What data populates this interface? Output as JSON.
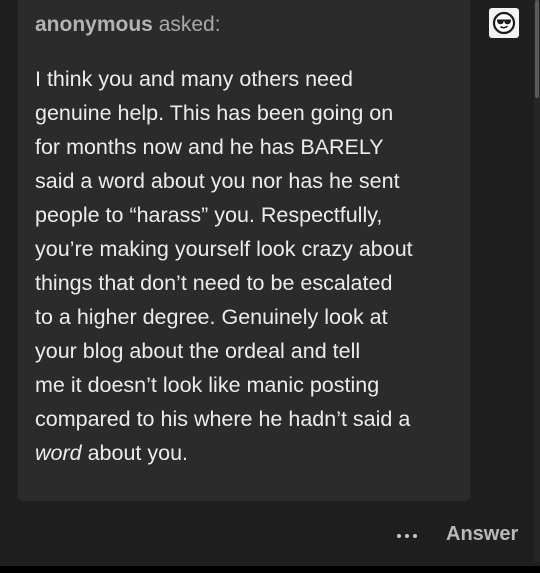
{
  "ask": {
    "asker_name": "anonymous",
    "asked_label": "asked:",
    "question_lines": [
      "I think you and many others need",
      "genuine help. This has been going on",
      "for months now and he has BARELY",
      "said a word about you nor has he sent",
      "people to “harass” you. Respectfully,",
      "you’re making yourself look crazy about",
      "things that don’t need to be escalated",
      "to a higher degree. Genuinely look at",
      "your blog about the ordeal and tell",
      "me it doesn’t look like manic posting",
      "compared to his where he hadn’t said a"
    ],
    "last_line_italic": "word",
    "last_line_rest": " about you."
  },
  "footer": {
    "more_icon": "ellipsis-icon",
    "answer_label": "Answer"
  },
  "avatar": {
    "icon": "sunglasses-face-icon"
  },
  "colors": {
    "background": "#1f1f1f",
    "card": "#2b2b2b",
    "text": "#ececec",
    "muted": "#a9a9a9"
  }
}
